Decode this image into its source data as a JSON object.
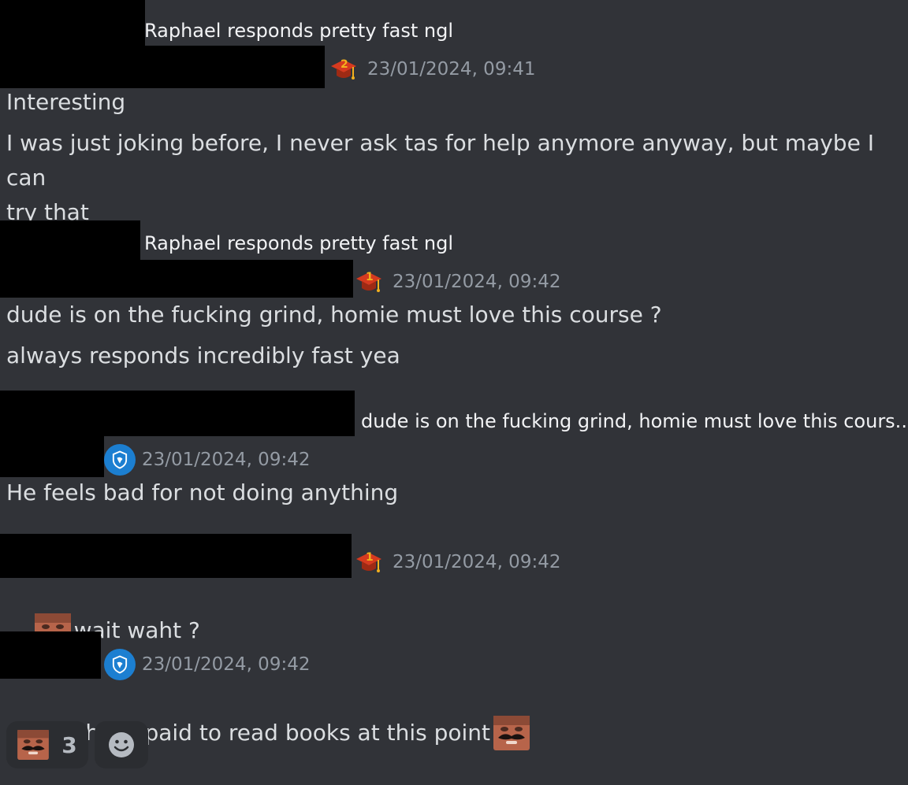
{
  "messages": [
    {
      "reply_preview": "Raphael responds pretty fast ngl",
      "badge": "graduation-cap-2-icon",
      "timestamp": "23/01/2024, 09:41",
      "lines": [
        "Interesting",
        "I was just joking before, I never ask tas for help anymore anyway, but maybe I can\ntry that"
      ]
    },
    {
      "reply_preview": "Raphael responds pretty fast ngl",
      "badge": "graduation-cap-1-icon",
      "timestamp": "23/01/2024, 09:42",
      "lines": [
        "dude is on the fucking grind, homie must love this course ?",
        "always responds incredibly fast yea"
      ]
    },
    {
      "reply_preview": "dude is on the fucking grind, homie must love this cours...",
      "badge": "blue-crest-icon",
      "timestamp": "23/01/2024, 09:42",
      "lines": [
        "He feels bad for not doing anything"
      ]
    },
    {
      "badge": "graduation-cap-1-icon",
      "timestamp": "23/01/2024, 09:42",
      "lines": [
        "wait waht ?"
      ],
      "leading_emoji": "mustache-man-emoji"
    },
    {
      "badge": "blue-crest-icon",
      "timestamp": "23/01/2024, 09:42",
      "lines": [
        "Like he is paid to read books at this point"
      ],
      "trailing_emoji": "mustache-man-emoji"
    }
  ],
  "reactions": [
    {
      "emoji": "mustache-man-emoji",
      "count": "3"
    },
    {
      "emoji": "add-reaction-smiley-icon"
    }
  ],
  "colors": {
    "background": "#313338",
    "timestamp": "#949ba4",
    "text": "#dbdee1",
    "reaction_bg": "#2b2d31",
    "badge_blue": "#1c7fd1",
    "cap_red": "#d63a1f",
    "cap_gold": "#f2b01e"
  }
}
